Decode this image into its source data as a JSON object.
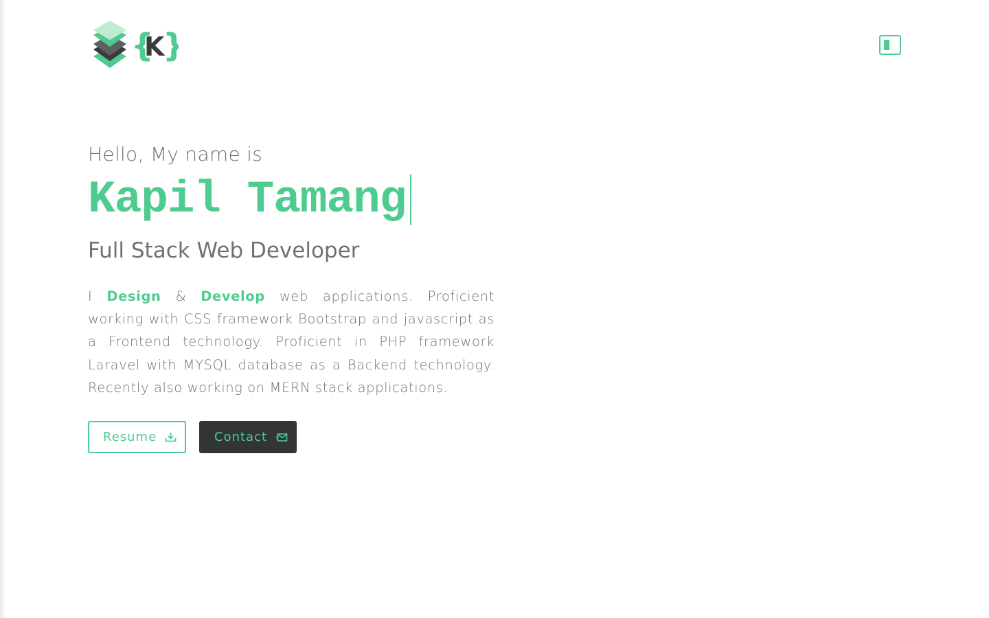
{
  "brand": {
    "logo_text": "{K}",
    "logo_icon": "layered-stack-icon"
  },
  "nav": {
    "menu_toggle_icon": "sidebar-toggle-icon"
  },
  "hero": {
    "greeting": "Hello, My name is",
    "name": "Kapil Tamang",
    "role": "Full Stack Web Developer",
    "intro": {
      "prefix": "I ",
      "highlight_1": "Design",
      "connector": " & ",
      "highlight_2": "Develop",
      "rest": " web applications. Proficient working with CSS framework Bootstrap and javascript as a Frontend technology. Proficient in PHP framework Laravel with MYSQL database as a Backend technology. Recently also working on MERN stack applications."
    }
  },
  "actions": {
    "resume_label": "Resume",
    "resume_icon": "download-icon",
    "contact_label": "Contact",
    "contact_icon": "mail-send-icon"
  },
  "colors": {
    "accent": "#4ecb8f",
    "text_muted": "#6f7177",
    "dark_button": "#333435",
    "background": "#ffffff"
  }
}
